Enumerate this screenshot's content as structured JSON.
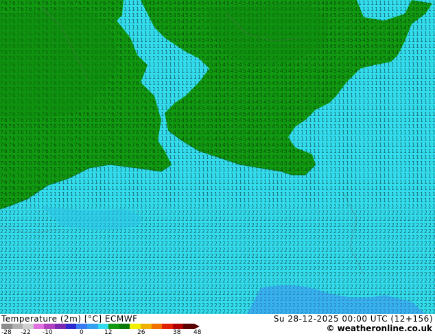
{
  "map": {
    "land_color": "#119a11",
    "land_dark_color": "#0d8a0d",
    "sea_color": "#33dcec",
    "sea_dark_color": "#2bc3e6",
    "cold_color": "#3a8ff0",
    "digit_color": "#000000"
  },
  "footer": {
    "title": "Temperature (2m) [°C] ECMWF",
    "datetime": "Su 28-12-2025 00:00 UTC (12+156)",
    "credit": "© weatheronline.co.uk"
  },
  "legend": {
    "labels": [
      "-28",
      "-22",
      "-10",
      "0",
      "12",
      "26",
      "38",
      "48"
    ],
    "colors": [
      "#8c8c8c",
      "#b0b0b0",
      "#cfcfcf",
      "#e070e0",
      "#b040c0",
      "#7a2ab0",
      "#2a2ad0",
      "#3a7af0",
      "#33a0f0",
      "#33dcec",
      "#119a11",
      "#0b7a0b",
      "#f0f000",
      "#f0b000",
      "#f07000",
      "#e02000",
      "#b00000",
      "#5a0000"
    ]
  }
}
